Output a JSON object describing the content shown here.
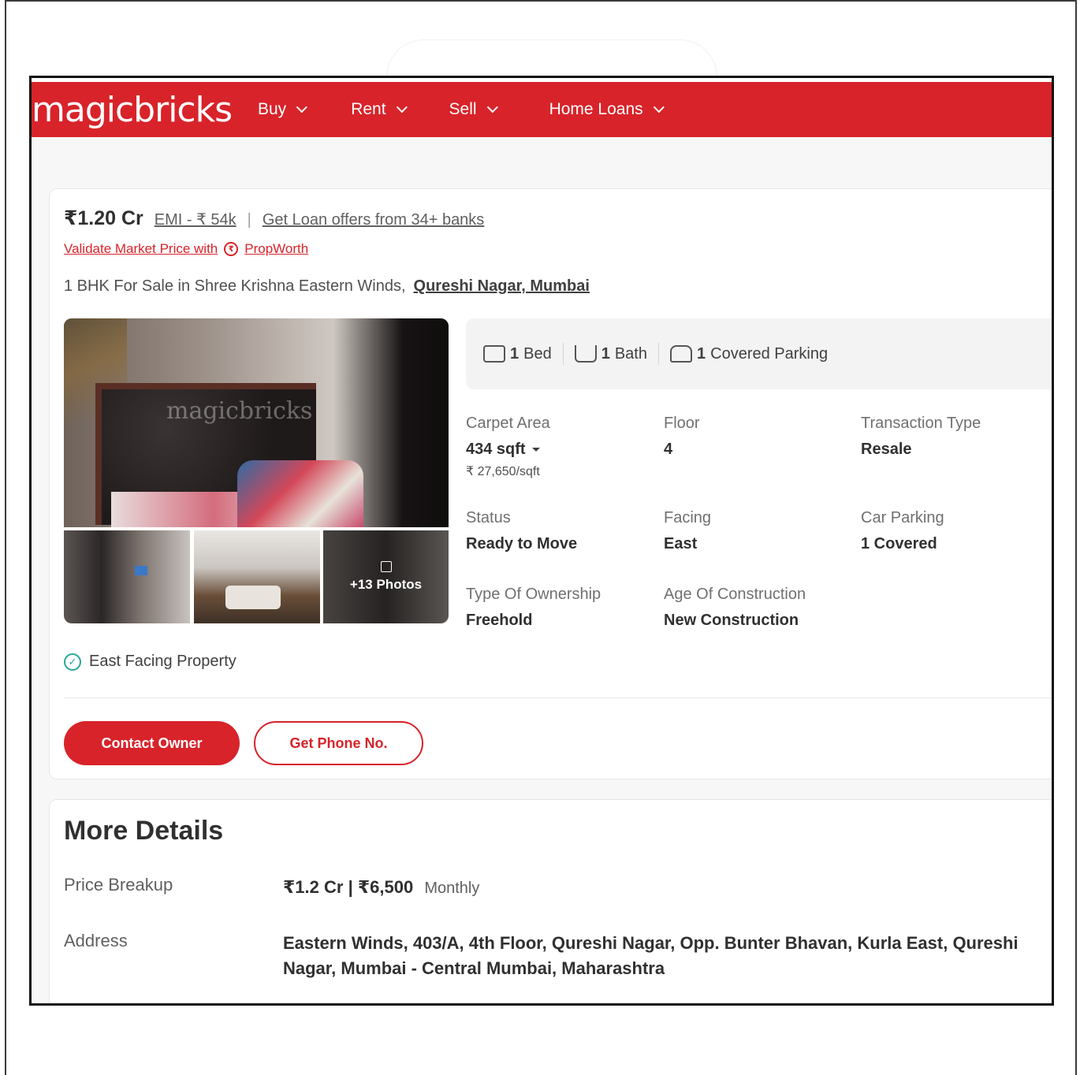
{
  "header": {
    "logo": "magicbricks",
    "nav": [
      {
        "label": "Buy"
      },
      {
        "label": "Rent"
      },
      {
        "label": "Sell"
      },
      {
        "label": "Home Loans"
      }
    ],
    "brand_color": "#d8232a"
  },
  "listing": {
    "price": "₹1.20 Cr",
    "emi": "EMI - ₹ 54k",
    "separator": "|",
    "loan_offer": "Get Loan offers from 34+ banks",
    "validate_text": "Validate Market Price with",
    "propworth": "PropWorth",
    "title_text": "1 BHK For Sale in Shree Krishna Eastern Winds,",
    "location": "Qureshi Nagar, Mumbai",
    "photo_watermark": "magicbricks",
    "more_photos": "+13 Photos",
    "east_facing": "East Facing Property",
    "contact_owner": "Contact Owner",
    "get_phone": "Get Phone No."
  },
  "amenities": {
    "bed_count": "1",
    "bed_label": "Bed",
    "bath_count": "1",
    "bath_label": "Bath",
    "parking_count": "1",
    "parking_label": "Covered Parking"
  },
  "details": {
    "carpet_area_label": "Carpet Area",
    "carpet_area_value": "434 sqft",
    "price_per_sqft": "₹ 27,650/sqft",
    "floor_label": "Floor",
    "floor_value": "4",
    "transaction_label": "Transaction Type",
    "transaction_value": "Resale",
    "status_label": "Status",
    "status_value": "Ready to Move",
    "facing_label": "Facing",
    "facing_value": "East",
    "car_parking_label": "Car Parking",
    "car_parking_value": "1 Covered",
    "ownership_label": "Type Of Ownership",
    "ownership_value": "Freehold",
    "age_label": "Age Of Construction",
    "age_value": "New Construction"
  },
  "more_details": {
    "title": "More Details",
    "price_breakup_label": "Price Breakup",
    "price_breakup_value": "₹1.2 Cr | ₹6,500",
    "price_breakup_suffix": "Monthly",
    "address_label": "Address",
    "address_value": "Eastern Winds, 403/A, 4th Floor, Qureshi Nagar, Opp. Bunter Bhavan, Kurla East, Qureshi Nagar, Mumbai - Central Mumbai, Maharashtra"
  }
}
